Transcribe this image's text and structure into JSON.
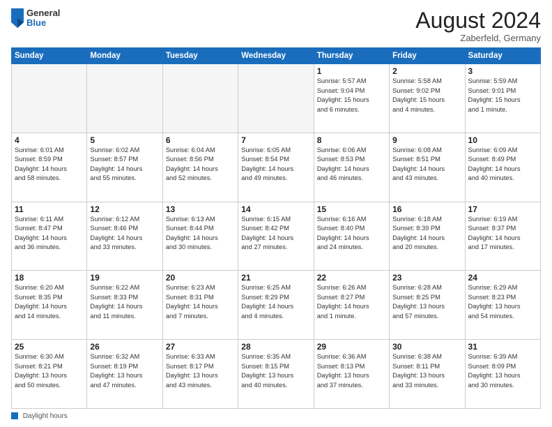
{
  "header": {
    "logo_general": "General",
    "logo_blue": "Blue",
    "month_title": "August 2024",
    "subtitle": "Zaberfeld, Germany"
  },
  "footer": {
    "label": "Daylight hours"
  },
  "weekdays": [
    "Sunday",
    "Monday",
    "Tuesday",
    "Wednesday",
    "Thursday",
    "Friday",
    "Saturday"
  ],
  "weeks": [
    [
      {
        "num": "",
        "info": ""
      },
      {
        "num": "",
        "info": ""
      },
      {
        "num": "",
        "info": ""
      },
      {
        "num": "",
        "info": ""
      },
      {
        "num": "1",
        "info": "Sunrise: 5:57 AM\nSunset: 9:04 PM\nDaylight: 15 hours\nand 6 minutes."
      },
      {
        "num": "2",
        "info": "Sunrise: 5:58 AM\nSunset: 9:02 PM\nDaylight: 15 hours\nand 4 minutes."
      },
      {
        "num": "3",
        "info": "Sunrise: 5:59 AM\nSunset: 9:01 PM\nDaylight: 15 hours\nand 1 minute."
      }
    ],
    [
      {
        "num": "4",
        "info": "Sunrise: 6:01 AM\nSunset: 8:59 PM\nDaylight: 14 hours\nand 58 minutes."
      },
      {
        "num": "5",
        "info": "Sunrise: 6:02 AM\nSunset: 8:57 PM\nDaylight: 14 hours\nand 55 minutes."
      },
      {
        "num": "6",
        "info": "Sunrise: 6:04 AM\nSunset: 8:56 PM\nDaylight: 14 hours\nand 52 minutes."
      },
      {
        "num": "7",
        "info": "Sunrise: 6:05 AM\nSunset: 8:54 PM\nDaylight: 14 hours\nand 49 minutes."
      },
      {
        "num": "8",
        "info": "Sunrise: 6:06 AM\nSunset: 8:53 PM\nDaylight: 14 hours\nand 46 minutes."
      },
      {
        "num": "9",
        "info": "Sunrise: 6:08 AM\nSunset: 8:51 PM\nDaylight: 14 hours\nand 43 minutes."
      },
      {
        "num": "10",
        "info": "Sunrise: 6:09 AM\nSunset: 8:49 PM\nDaylight: 14 hours\nand 40 minutes."
      }
    ],
    [
      {
        "num": "11",
        "info": "Sunrise: 6:11 AM\nSunset: 8:47 PM\nDaylight: 14 hours\nand 36 minutes."
      },
      {
        "num": "12",
        "info": "Sunrise: 6:12 AM\nSunset: 8:46 PM\nDaylight: 14 hours\nand 33 minutes."
      },
      {
        "num": "13",
        "info": "Sunrise: 6:13 AM\nSunset: 8:44 PM\nDaylight: 14 hours\nand 30 minutes."
      },
      {
        "num": "14",
        "info": "Sunrise: 6:15 AM\nSunset: 8:42 PM\nDaylight: 14 hours\nand 27 minutes."
      },
      {
        "num": "15",
        "info": "Sunrise: 6:16 AM\nSunset: 8:40 PM\nDaylight: 14 hours\nand 24 minutes."
      },
      {
        "num": "16",
        "info": "Sunrise: 6:18 AM\nSunset: 8:39 PM\nDaylight: 14 hours\nand 20 minutes."
      },
      {
        "num": "17",
        "info": "Sunrise: 6:19 AM\nSunset: 8:37 PM\nDaylight: 14 hours\nand 17 minutes."
      }
    ],
    [
      {
        "num": "18",
        "info": "Sunrise: 6:20 AM\nSunset: 8:35 PM\nDaylight: 14 hours\nand 14 minutes."
      },
      {
        "num": "19",
        "info": "Sunrise: 6:22 AM\nSunset: 8:33 PM\nDaylight: 14 hours\nand 11 minutes."
      },
      {
        "num": "20",
        "info": "Sunrise: 6:23 AM\nSunset: 8:31 PM\nDaylight: 14 hours\nand 7 minutes."
      },
      {
        "num": "21",
        "info": "Sunrise: 6:25 AM\nSunset: 8:29 PM\nDaylight: 14 hours\nand 4 minutes."
      },
      {
        "num": "22",
        "info": "Sunrise: 6:26 AM\nSunset: 8:27 PM\nDaylight: 14 hours\nand 1 minute."
      },
      {
        "num": "23",
        "info": "Sunrise: 6:28 AM\nSunset: 8:25 PM\nDaylight: 13 hours\nand 57 minutes."
      },
      {
        "num": "24",
        "info": "Sunrise: 6:29 AM\nSunset: 8:23 PM\nDaylight: 13 hours\nand 54 minutes."
      }
    ],
    [
      {
        "num": "25",
        "info": "Sunrise: 6:30 AM\nSunset: 8:21 PM\nDaylight: 13 hours\nand 50 minutes."
      },
      {
        "num": "26",
        "info": "Sunrise: 6:32 AM\nSunset: 8:19 PM\nDaylight: 13 hours\nand 47 minutes."
      },
      {
        "num": "27",
        "info": "Sunrise: 6:33 AM\nSunset: 8:17 PM\nDaylight: 13 hours\nand 43 minutes."
      },
      {
        "num": "28",
        "info": "Sunrise: 6:35 AM\nSunset: 8:15 PM\nDaylight: 13 hours\nand 40 minutes."
      },
      {
        "num": "29",
        "info": "Sunrise: 6:36 AM\nSunset: 8:13 PM\nDaylight: 13 hours\nand 37 minutes."
      },
      {
        "num": "30",
        "info": "Sunrise: 6:38 AM\nSunset: 8:11 PM\nDaylight: 13 hours\nand 33 minutes."
      },
      {
        "num": "31",
        "info": "Sunrise: 6:39 AM\nSunset: 8:09 PM\nDaylight: 13 hours\nand 30 minutes."
      }
    ]
  ]
}
